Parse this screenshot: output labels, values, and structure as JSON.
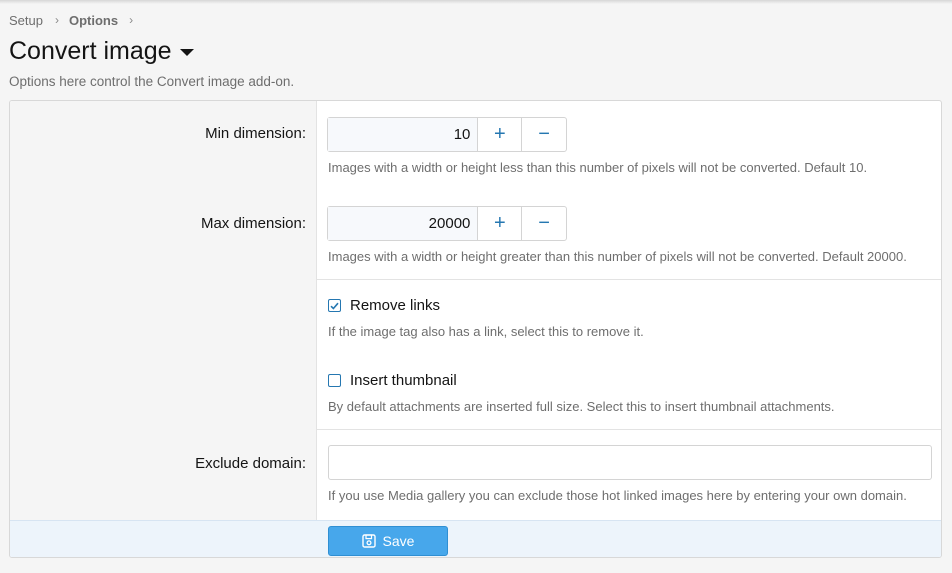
{
  "breadcrumb": {
    "items": [
      "Setup",
      "Options"
    ]
  },
  "page": {
    "title": "Convert image",
    "subtitle": "Options here control the Convert image add-on."
  },
  "form": {
    "min_dimension": {
      "label": "Min dimension:",
      "value": "10",
      "hint": "Images with a width or height less than this number of pixels will not be converted. Default 10."
    },
    "max_dimension": {
      "label": "Max dimension:",
      "value": "20000",
      "hint": "Images with a width or height greater than this number of pixels will not be converted. Default 20000."
    },
    "spin": {
      "plus": "+",
      "minus": "−"
    },
    "remove_links": {
      "label": "Remove links",
      "checked": true,
      "hint": "If the image tag also has a link, select this to remove it."
    },
    "insert_thumbnail": {
      "label": "Insert thumbnail",
      "checked": false,
      "hint": "By default attachments are inserted full size. Select this to insert thumbnail attachments."
    },
    "exclude_domain": {
      "label": "Exclude domain:",
      "value": "",
      "hint": "If you use Media gallery you can exclude those hot linked images here by entering your own domain."
    },
    "save_label": "Save"
  },
  "colors": {
    "accent": "#47a7eb",
    "link_blue": "#2577b1",
    "footer_bg": "#edf4fb"
  },
  "icons": {
    "breadcrumb_separator": "chevron-right-icon",
    "title_menu": "caret-down-icon",
    "checkbox_checked": "checkmark-icon",
    "save": "floppy-disk-icon"
  }
}
